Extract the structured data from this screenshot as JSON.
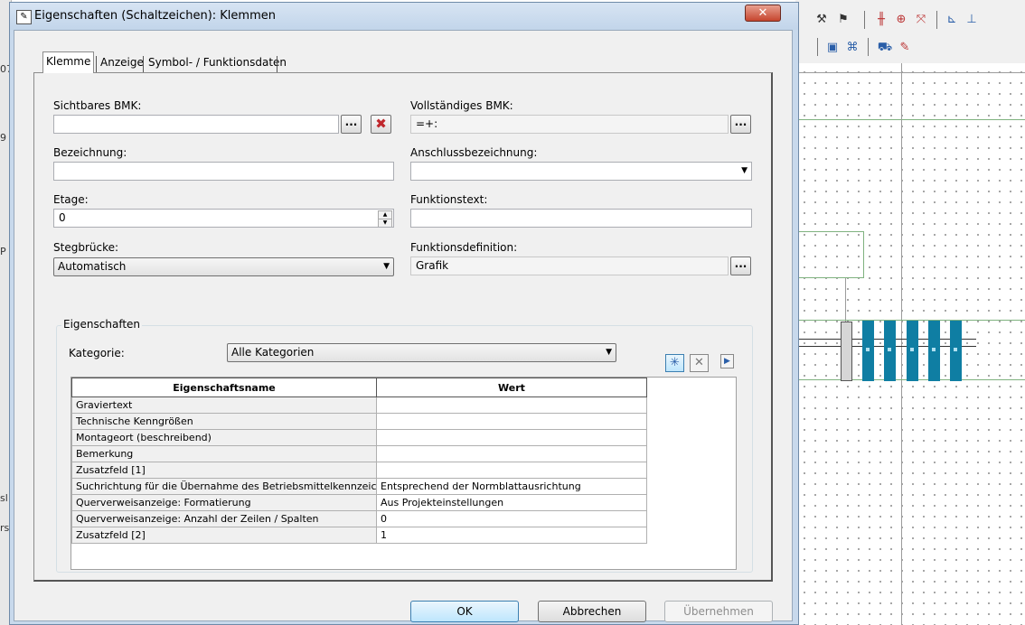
{
  "window": {
    "title": "Eigenschaften (Schaltzeichen): Klemmen",
    "close_label": "✕"
  },
  "tabs": [
    {
      "label": "Klemme"
    },
    {
      "label": "Anzeige"
    },
    {
      "label": "Symbol- / Funktionsdaten"
    }
  ],
  "form": {
    "sichtbares_bmk": {
      "label": "Sichtbares BMK:",
      "value": ""
    },
    "vollstaendiges_bmk": {
      "label": "Vollständiges BMK:",
      "value": "=+:"
    },
    "bezeichnung": {
      "label": "Bezeichnung:",
      "value": ""
    },
    "anschlussbezeichnung": {
      "label": "Anschlussbezeichnung:",
      "value": ""
    },
    "etage": {
      "label": "Etage:",
      "value": "0"
    },
    "funktionstext": {
      "label": "Funktionstext:",
      "value": ""
    },
    "stegbruecke": {
      "label": "Stegbrücke:",
      "value": "Automatisch"
    },
    "funktionsdefinition": {
      "label": "Funktionsdefinition:",
      "value": "Grafik"
    },
    "dots_label": "..."
  },
  "properties": {
    "group_label": "Eigenschaften",
    "category_label": "Kategorie:",
    "category_value": "Alle Kategorien",
    "columns": [
      "Eigenschaftsname",
      "Wert"
    ],
    "rows": [
      {
        "name": "Graviertext",
        "value": ""
      },
      {
        "name": "Technische Kenngrößen",
        "value": ""
      },
      {
        "name": "Montageort (beschreibend)",
        "value": ""
      },
      {
        "name": "Bemerkung",
        "value": ""
      },
      {
        "name": "Zusatzfeld [1]",
        "value": ""
      },
      {
        "name": "Suchrichtung für die Übernahme des Betriebsmittelkennzeic...",
        "value": "Entsprechend der Normblattausrichtung"
      },
      {
        "name": "Querverweisanzeige: Formatierung",
        "value": "Aus Projekteinstellungen"
      },
      {
        "name": "Querverweisanzeige: Anzahl der Zeilen / Spalten",
        "value": "0"
      },
      {
        "name": "Zusatzfeld [2]",
        "value": "1"
      }
    ]
  },
  "buttons": {
    "ok": "OK",
    "cancel": "Abbrechen",
    "apply": "Übernehmen"
  },
  "background": {
    "left_strip_chars": [
      "07",
      "9",
      "P",
      "sl",
      "rs"
    ]
  }
}
